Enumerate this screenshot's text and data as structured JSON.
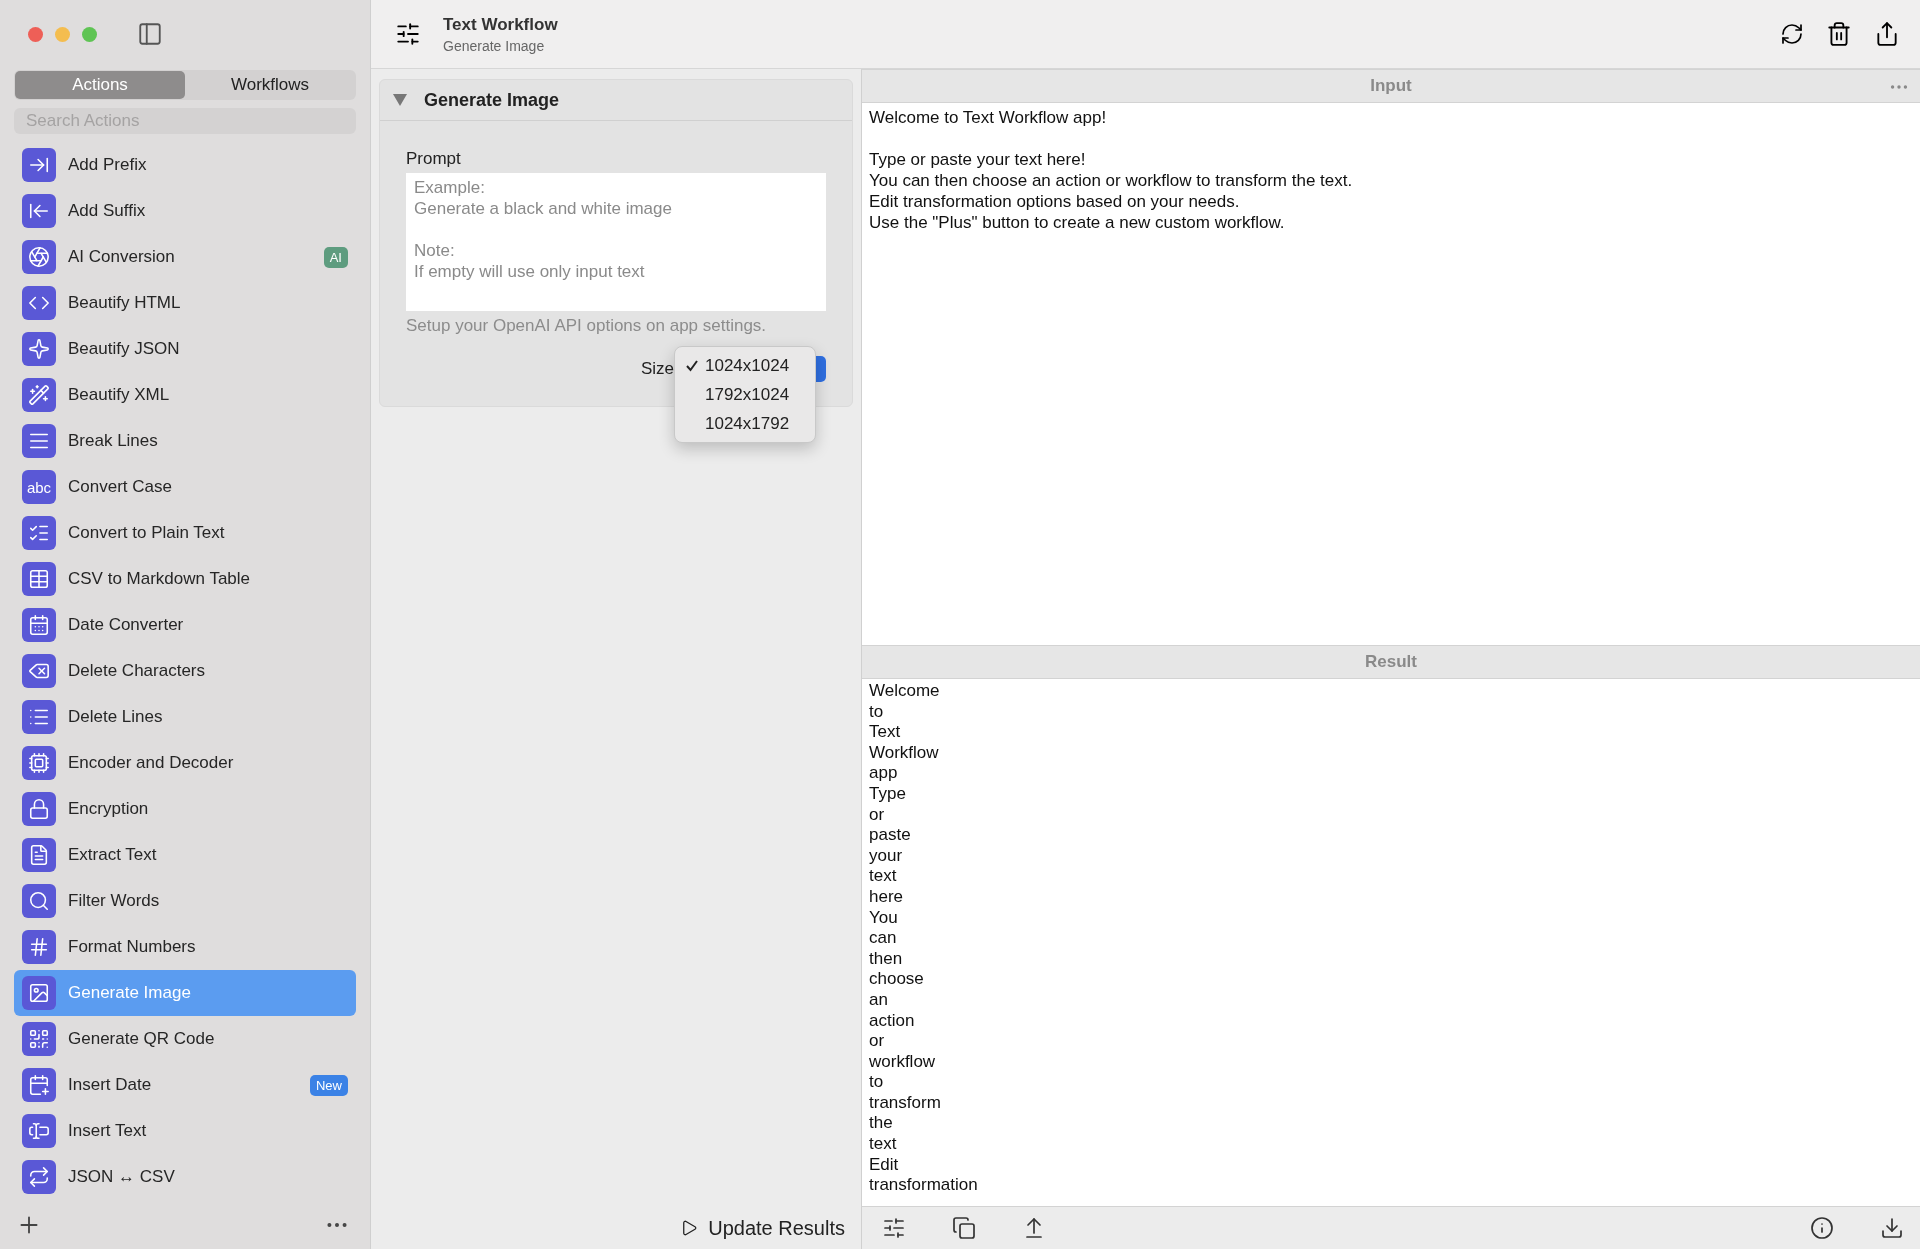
{
  "window": {
    "title": "Text Workflow",
    "subtitle": "Generate Image"
  },
  "sidebar": {
    "tabs": [
      {
        "label": "Actions",
        "selected": true
      },
      {
        "label": "Workflows",
        "selected": false
      }
    ],
    "search": {
      "placeholder": "Search Actions"
    },
    "items": [
      {
        "label": "Add Prefix",
        "selected": false
      },
      {
        "label": "Add Suffix",
        "selected": false
      },
      {
        "label": "AI Conversion",
        "selected": false,
        "badge": {
          "text": "AI",
          "color": "#5e9c7f"
        }
      },
      {
        "label": "Beautify HTML",
        "selected": false
      },
      {
        "label": "Beautify JSON",
        "selected": false
      },
      {
        "label": "Beautify XML",
        "selected": false
      },
      {
        "label": "Break Lines",
        "selected": false
      },
      {
        "label": "Convert Case",
        "selected": false,
        "icon_text": "abc"
      },
      {
        "label": "Convert to Plain Text",
        "selected": false
      },
      {
        "label": "CSV to Markdown Table",
        "selected": false
      },
      {
        "label": "Date Converter",
        "selected": false
      },
      {
        "label": "Delete Characters",
        "selected": false
      },
      {
        "label": "Delete Lines",
        "selected": false
      },
      {
        "label": "Encoder and Decoder",
        "selected": false
      },
      {
        "label": "Encryption",
        "selected": false
      },
      {
        "label": "Extract Text",
        "selected": false
      },
      {
        "label": "Filter Words",
        "selected": false
      },
      {
        "label": "Format Numbers",
        "selected": false
      },
      {
        "label": "Generate Image",
        "selected": true
      },
      {
        "label": "Generate QR Code",
        "selected": false
      },
      {
        "label": "Insert Date",
        "selected": false,
        "badge": {
          "text": "New",
          "color": "#3b82e6"
        }
      },
      {
        "label": "Insert Text",
        "selected": false
      },
      {
        "label": "JSON ↔ CSV",
        "selected": false
      }
    ]
  },
  "action_panel": {
    "title": "Generate Image",
    "expanded": true,
    "prompt_label": "Prompt",
    "prompt_placeholder": "Example:\nGenerate a black and white image\n\nNote:\nIf empty will use only input text",
    "hint": "Setup your OpenAI API options on app settings.",
    "size_label": "Size",
    "size_options": [
      {
        "label": "1024x1024",
        "selected": true
      },
      {
        "label": "1792x1024",
        "selected": false
      },
      {
        "label": "1024x1792",
        "selected": false
      }
    ],
    "update_button": "Update Results"
  },
  "input": {
    "header": "Input",
    "text": "Welcome to Text Workflow app!\n\nType or paste your text here!\nYou can then choose an action or workflow to transform the text.\nEdit transformation options based on your needs.\nUse the \"Plus\" button to create a new custom workflow."
  },
  "result": {
    "header": "Result",
    "lines": [
      "Welcome",
      "to",
      "Text",
      "Workflow",
      "app",
      "Type",
      "or",
      "paste",
      "your",
      "text",
      "here",
      "You",
      "can",
      "then",
      "choose",
      "an",
      "action",
      "or",
      "workflow",
      "to",
      "transform",
      "the",
      "text",
      "Edit",
      "transformation"
    ]
  }
}
